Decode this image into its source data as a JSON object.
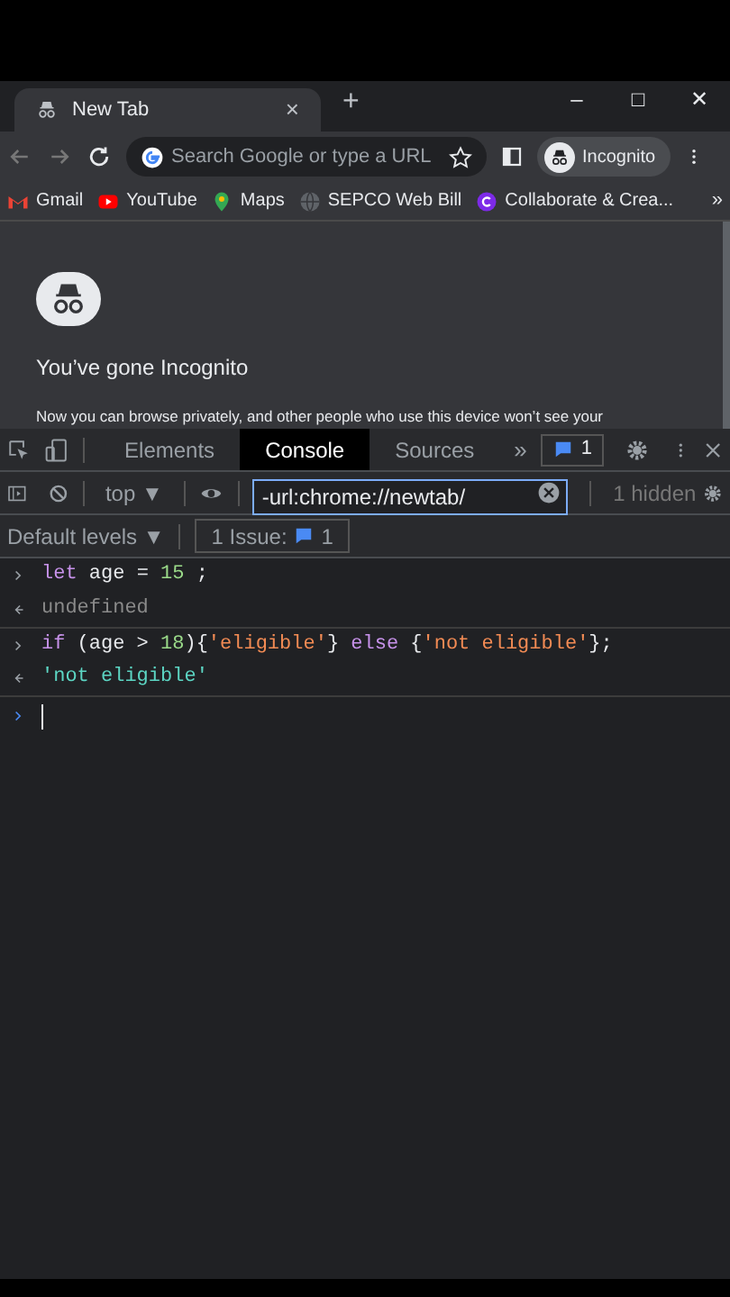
{
  "browser_tab": {
    "title": "New Tab",
    "close": "×"
  },
  "new_tab_button": "+",
  "window_controls": [
    "–",
    "□",
    "✕"
  ],
  "address_bar": {
    "placeholder": "Search Google or type a URL"
  },
  "profile": {
    "label": "Incognito"
  },
  "bookmarks": [
    {
      "label": "Gmail",
      "kind": "gmail"
    },
    {
      "label": "YouTube",
      "kind": "youtube"
    },
    {
      "label": "Maps",
      "kind": "maps"
    },
    {
      "label": "SEPCO Web Bill",
      "kind": "globe"
    },
    {
      "label": "Collaborate & Crea...",
      "kind": "canva"
    }
  ],
  "bookmarks_more": "»",
  "page": {
    "heading": "You’ve gone Incognito",
    "text": "Now you can browse privately, and other people who use this device won’t see your"
  },
  "devtools": {
    "tabs": [
      {
        "label": "Elements",
        "selected": false
      },
      {
        "label": "Console",
        "selected": true
      },
      {
        "label": "Sources",
        "selected": false
      }
    ],
    "more_tabs": "»",
    "messages_badge": "1",
    "context": "top ▼",
    "filter": {
      "value": "-url:chrome://newtab/"
    },
    "hidden": "1 hidden",
    "levels": "Default levels ▼",
    "issues": {
      "label": "1 Issue:",
      "count": "1"
    },
    "console": [
      {
        "kind": "input",
        "tokens": [
          {
            "kind": "keyword",
            "text": "let"
          },
          {
            "kind": "plain",
            "text": " age = "
          },
          {
            "kind": "number",
            "text": "15"
          },
          {
            "kind": "plain",
            "text": " ;"
          }
        ]
      },
      {
        "kind": "output",
        "tokens": [
          {
            "kind": "muted",
            "text": "undefined"
          }
        ]
      },
      {
        "kind": "input",
        "tokens": [
          {
            "kind": "keyword",
            "text": "if"
          },
          {
            "kind": "plain",
            "text": " (age > "
          },
          {
            "kind": "number",
            "text": "18"
          },
          {
            "kind": "plain",
            "text": "){"
          },
          {
            "kind": "string",
            "text": "'eligible'"
          },
          {
            "kind": "plain",
            "text": "} "
          },
          {
            "kind": "keyword",
            "text": "else"
          },
          {
            "kind": "plain",
            "text": " {"
          },
          {
            "kind": "string",
            "text": "'not eligible'"
          },
          {
            "kind": "plain",
            "text": "};"
          }
        ]
      },
      {
        "kind": "output",
        "tokens": [
          {
            "kind": "result",
            "text": "'not eligible'"
          }
        ]
      }
    ]
  }
}
